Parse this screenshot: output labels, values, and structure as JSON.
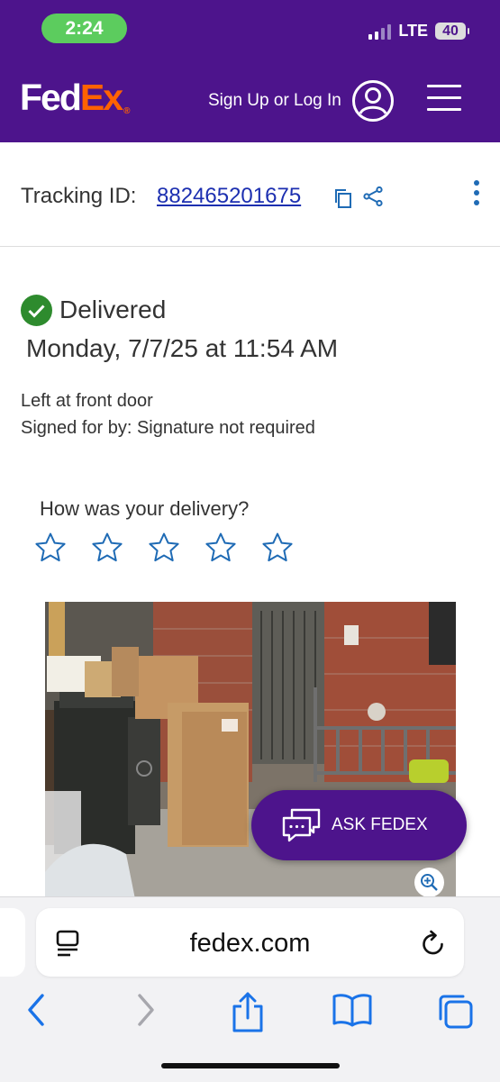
{
  "status_bar": {
    "time": "2:24",
    "network": "LTE",
    "battery": "40"
  },
  "header": {
    "logo_fed": "Fed",
    "logo_ex": "Ex",
    "logo_reg": "®",
    "signin_label": "Sign Up or Log In"
  },
  "tracking": {
    "label": "Tracking ID:",
    "id": "882465201675"
  },
  "delivery": {
    "status": "Delivered",
    "date": "Monday, 7/7/25 at 11:54 AM",
    "location": "Left at front door",
    "signature": "Signed for by: Signature not required"
  },
  "rating": {
    "question": "How was your delivery?",
    "stars": 5,
    "selected": 0
  },
  "ask": {
    "label": "ASK FEDEX"
  },
  "browser": {
    "url": "fedex.com"
  },
  "colors": {
    "brand_purple": "#4d148c",
    "brand_orange": "#ff6200",
    "link_blue": "#1c2fb0",
    "icon_blue": "#1f6bb5",
    "success_green": "#2e8b2e"
  },
  "icons": [
    "user-icon",
    "menu-icon",
    "copy-icon",
    "share-icon",
    "more-icon",
    "check-circle-icon",
    "star-icon",
    "chat-icon",
    "zoom-icon",
    "reader-icon",
    "reload-icon",
    "back-icon",
    "forward-icon",
    "share-icon",
    "bookmarks-icon",
    "tabs-icon"
  ]
}
